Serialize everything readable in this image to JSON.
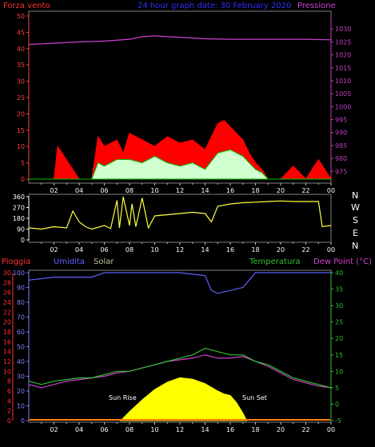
{
  "header": {
    "left": "Forza vento",
    "center": "24 hour graph date: 30 February 2020",
    "right": "Pressione"
  },
  "colors": {
    "background": "#000000",
    "grid": "#808080",
    "wind": "#ff0000",
    "gust": "#00c000",
    "pressure": "#d040d0",
    "direction": "#ffff40",
    "rain": "#ff3030",
    "humidity": "#6060ff",
    "solar": "#ffff00",
    "temperature": "#30c030",
    "dewpoint": "#d040d0",
    "left_axis": "#ff4040",
    "right_axis": "#c040c0"
  },
  "x_tick_labels": [
    "02",
    "04",
    "06",
    "08",
    "10",
    "12",
    "14",
    "16",
    "18",
    "20",
    "22",
    "00"
  ],
  "chart_data": [
    {
      "type": "line",
      "title": "24 hour graph date: 30 February 2020",
      "y_left": {
        "label": "Forza vento",
        "ylim": [
          0,
          50
        ],
        "ticks": [
          0,
          5,
          10,
          15,
          20,
          25,
          30,
          35,
          40,
          45,
          50
        ]
      },
      "y_right": {
        "label": "Pressione",
        "ylim": [
          972,
          1035
        ],
        "ticks": [
          975,
          980,
          985,
          990,
          995,
          1000,
          1005,
          1010,
          1015,
          1020,
          1025,
          1030
        ]
      },
      "x_label_ticks": [
        "02",
        "04",
        "06",
        "08",
        "10",
        "12",
        "14",
        "16",
        "18",
        "20",
        "22",
        "00"
      ],
      "grid": false,
      "series": [
        {
          "name": "Pressione",
          "axis": "right",
          "x": [
            0,
            2,
            4,
            6,
            8,
            9,
            10,
            11,
            12,
            14,
            16,
            18,
            20,
            22,
            24
          ],
          "values": [
            1024,
            1024.5,
            1025,
            1025.3,
            1026,
            1027,
            1027.3,
            1027,
            1026.8,
            1026.2,
            1026,
            1026,
            1026,
            1026,
            1025.8
          ]
        },
        {
          "name": "Forza vento",
          "axis": "left",
          "x": [
            0,
            2,
            2.3,
            4,
            5,
            5.5,
            6,
            7,
            7.5,
            8,
            9,
            10,
            11,
            12,
            13,
            14,
            15,
            15.5,
            16,
            16.5,
            17,
            17.5,
            18,
            18.5,
            19,
            20,
            21,
            22,
            23,
            24
          ],
          "values": [
            0,
            0,
            10,
            0,
            0,
            13,
            10,
            12,
            8,
            14,
            12,
            10,
            13,
            11,
            12,
            9,
            17,
            18,
            16,
            14,
            12,
            8,
            5,
            3,
            0,
            0,
            4,
            0,
            6,
            0
          ]
        },
        {
          "name": "Raffica",
          "axis": "left",
          "x": [
            0,
            5,
            5.5,
            6,
            7,
            8,
            9,
            10,
            11,
            12,
            13,
            14,
            15,
            16,
            17,
            18,
            18.5,
            19,
            24
          ],
          "values": [
            0,
            0,
            5,
            4,
            6,
            6,
            5,
            7,
            5,
            4,
            5,
            3,
            8,
            9,
            7,
            3,
            2,
            0,
            0
          ]
        }
      ]
    },
    {
      "type": "line",
      "y_left": {
        "ylim": [
          0,
          360
        ],
        "ticks": [
          0,
          90,
          180,
          270,
          360
        ]
      },
      "y_right_labels": [
        "N",
        "W",
        "S",
        "E",
        "N"
      ],
      "x_label_ticks": [
        "02",
        "04",
        "06",
        "08",
        "10",
        "12",
        "14",
        "16",
        "18",
        "20",
        "22",
        "00"
      ],
      "series": [
        {
          "name": "Direzione vento",
          "x": [
            0,
            1,
            2,
            3,
            3.5,
            4,
            4.5,
            5,
            6,
            6.5,
            7,
            7.2,
            7.5,
            8,
            8.2,
            8.5,
            9,
            9.5,
            10,
            11,
            12,
            13,
            14,
            14.5,
            15,
            16,
            17,
            18,
            19,
            20,
            21,
            22,
            23,
            23.3,
            24
          ],
          "values": [
            100,
            90,
            110,
            100,
            240,
            150,
            110,
            90,
            120,
            95,
            330,
            100,
            360,
            120,
            300,
            110,
            350,
            100,
            200,
            210,
            220,
            230,
            220,
            150,
            280,
            300,
            310,
            315,
            320,
            325,
            320,
            320,
            320,
            110,
            120
          ]
        }
      ]
    },
    {
      "type": "line",
      "y_left": {
        "labels": [
          "Pioggia",
          "Umidita"
        ],
        "ylim": [
          0,
          100
        ],
        "ticks": [
          0,
          10,
          20,
          30,
          40,
          50,
          60,
          70,
          80,
          90,
          100
        ],
        "rain_ticks": [
          0,
          2,
          4,
          6,
          8,
          10,
          12,
          14,
          16,
          18,
          20,
          22,
          24,
          26,
          28,
          30
        ]
      },
      "y_right": {
        "labels": [
          "Temperatura",
          "Dew Point (°C)"
        ],
        "ylim": [
          -5,
          40
        ],
        "ticks": [
          -5,
          0,
          5,
          10,
          15,
          20,
          25,
          30,
          35,
          40
        ]
      },
      "x_label_ticks": [
        "02",
        "04",
        "06",
        "08",
        "10",
        "12",
        "14",
        "16",
        "18",
        "20",
        "22",
        "00"
      ],
      "annotations": [
        "Sun Rise",
        "Sun Set"
      ],
      "legend": [
        "Pioggia",
        "Umidita",
        "Solar",
        "Temperatura",
        "Dew Point (°C)"
      ],
      "series": [
        {
          "name": "Umidita",
          "axis": "left",
          "x": [
            0,
            2,
            4,
            5,
            6,
            8,
            10,
            12,
            14,
            14.5,
            15,
            16,
            17,
            17.5,
            18,
            20,
            22,
            24
          ],
          "values": [
            95,
            97,
            97,
            97,
            100,
            100,
            100,
            100,
            98,
            88,
            86,
            88,
            90,
            95,
            100,
            100,
            100,
            100
          ]
        },
        {
          "name": "Temperatura",
          "axis": "right",
          "x": [
            0,
            1,
            2,
            3,
            4,
            5,
            6,
            7,
            8,
            9,
            10,
            11,
            12,
            13,
            14,
            15,
            16,
            17,
            18,
            19,
            20,
            21,
            22,
            23,
            24
          ],
          "values": [
            7,
            6,
            7,
            7.5,
            8,
            8,
            9,
            10,
            10,
            11,
            12,
            13,
            14,
            15,
            17,
            16,
            15,
            15,
            13,
            12,
            10,
            8,
            7,
            6,
            5
          ]
        },
        {
          "name": "Dew Point",
          "axis": "right",
          "x": [
            0,
            1,
            2,
            3,
            4,
            5,
            6,
            7,
            8,
            9,
            10,
            11,
            12,
            13,
            14,
            15,
            16,
            17,
            18,
            19,
            20,
            21,
            22,
            23,
            24
          ],
          "values": [
            6,
            5,
            6,
            7,
            7.5,
            8,
            8.5,
            9.5,
            10,
            11,
            12,
            13,
            13.5,
            14,
            15,
            14,
            14,
            14.5,
            13,
            11.5,
            9.5,
            7.5,
            6.5,
            5.5,
            5
          ]
        },
        {
          "name": "Solar",
          "axis": "left",
          "x": [
            7.3,
            8,
            9,
            10,
            11,
            12,
            13,
            14,
            15,
            15.5,
            16,
            16.5,
            17,
            17.3
          ],
          "values": [
            0,
            6,
            14,
            21,
            26,
            29,
            28,
            25,
            20,
            18,
            17,
            12,
            5,
            0
          ]
        }
      ]
    }
  ],
  "labels": {
    "dir_right": [
      "N",
      "W",
      "S",
      "E",
      "N"
    ],
    "bottom_left_1": "Pioggia",
    "bottom_left_2": "Umidita",
    "bottom_left_3": "Solar",
    "bottom_right_1": "Temperatura",
    "bottom_right_2": "Dew Point (°C)",
    "sunrise": "Sun Rise",
    "sunset": "Sun Set"
  }
}
